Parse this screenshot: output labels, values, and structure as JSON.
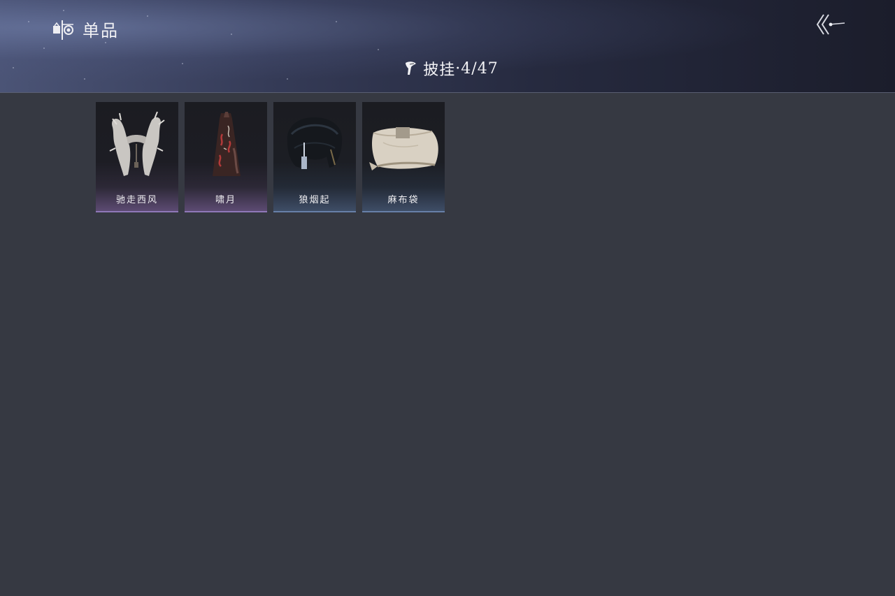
{
  "header": {
    "section_title": "单品",
    "section_icon": "sticker-eye-icon",
    "back_icon": "back-arrow-icon"
  },
  "category": {
    "icon": "cape-icon",
    "label": "披挂",
    "count": "·4/47"
  },
  "items": [
    {
      "name": "驰走西风",
      "rarity_color": "#8f78b8",
      "icon": "white-fur-cape-icon"
    },
    {
      "name": "啸月",
      "rarity_color": "#8f78b8",
      "icon": "red-pattern-cape-icon"
    },
    {
      "name": "狼烟起",
      "rarity_color": "#6780a8",
      "icon": "black-fur-cape-icon"
    },
    {
      "name": "麻布袋",
      "rarity_color": "#6780a8",
      "icon": "burlap-sack-icon"
    }
  ]
}
